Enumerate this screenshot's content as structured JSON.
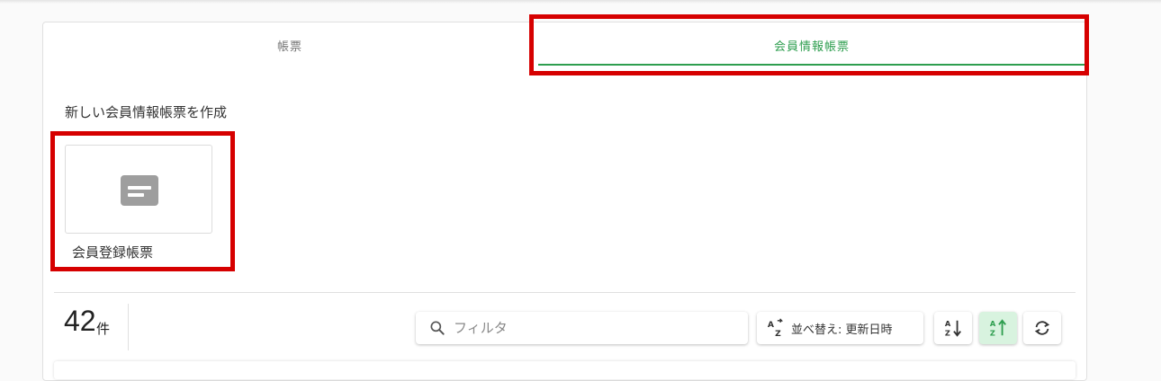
{
  "tabs": [
    {
      "label": "帳票",
      "active": false
    },
    {
      "label": "会員情報帳票",
      "active": true
    }
  ],
  "create_section": {
    "title": "新しい会員情報帳票を作成",
    "templates": [
      {
        "label": "会員登録帳票",
        "icon": "document-icon"
      }
    ]
  },
  "listing": {
    "count": "42",
    "count_unit": "件",
    "search": {
      "placeholder": "フィルタ",
      "value": ""
    },
    "sort": {
      "label": "並べ替え: 更新日時",
      "icon": "sort-az-icon"
    },
    "buttons": [
      {
        "name": "sort-descending",
        "icon": "sort-desc-icon",
        "active": false
      },
      {
        "name": "sort-ascending",
        "icon": "sort-asc-icon",
        "active": true
      },
      {
        "name": "refresh",
        "icon": "refresh-icon",
        "active": false
      }
    ]
  },
  "colors": {
    "accent": "#2e9e4f",
    "highlight": "#d60000",
    "active_button_bg": "#d8f3df"
  }
}
